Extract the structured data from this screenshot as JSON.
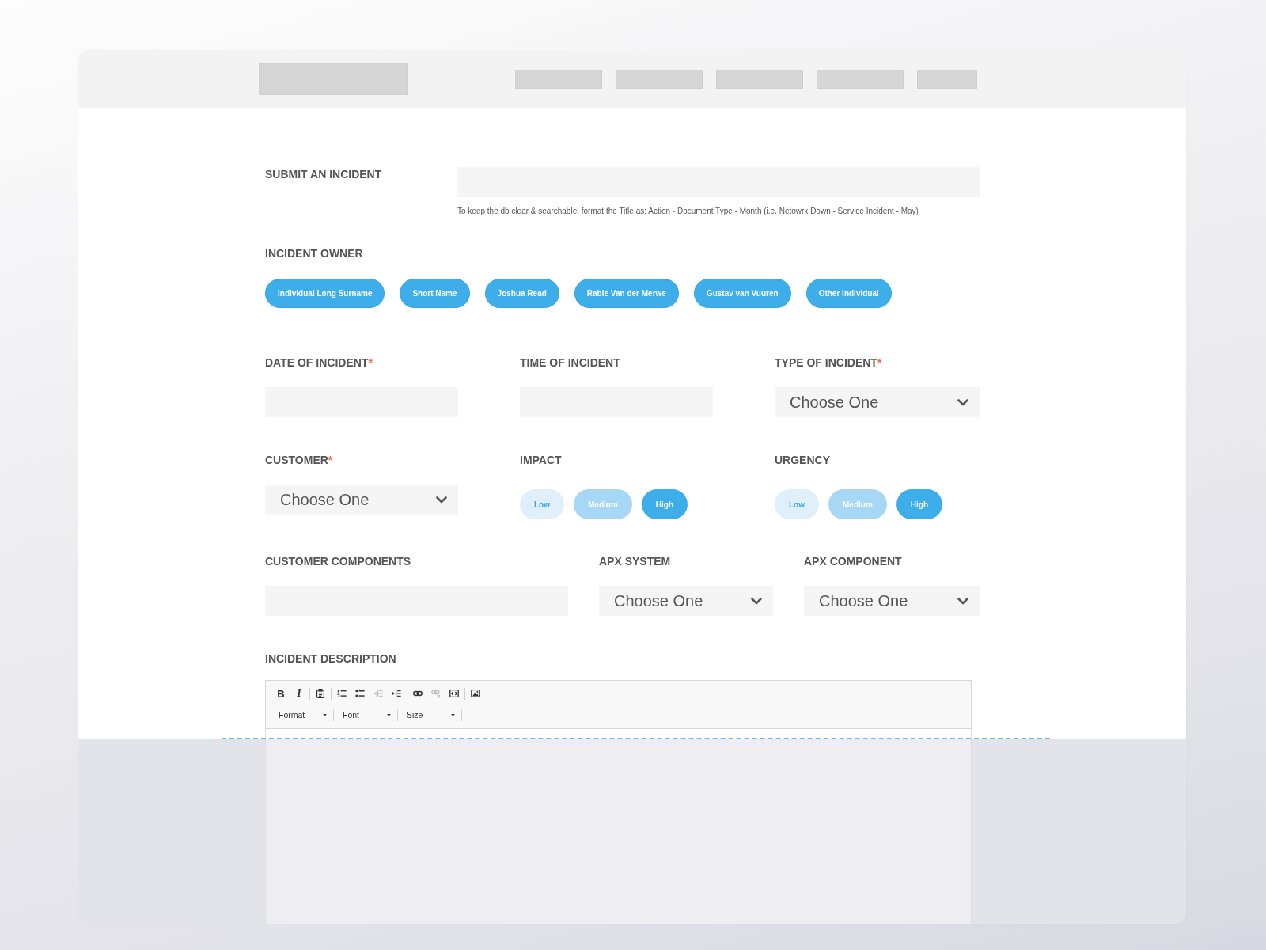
{
  "title_field": {
    "label": "SUBMIT AN INCIDENT",
    "hint": "To keep the db clear & searchable, format the Title as: Action - Document Type - Month (i.e. Netowrk Down - Service Incident - May)"
  },
  "incident_owner": {
    "label": "INCIDENT OWNER",
    "options": [
      "Individual Long Surname",
      "Short Name",
      "Joshua Read",
      "Rabie Van der Merwe",
      "Gustav van Vuuren",
      "Other Individual"
    ]
  },
  "field_rows": [
    [
      {
        "kind": "input",
        "label": "DATE OF INCIDENT",
        "required_mark": "*"
      },
      {
        "kind": "input",
        "label": "TIME OF INCIDENT"
      },
      {
        "kind": "select",
        "label": "TYPE OF INCIDENT",
        "required_mark": "*",
        "value": "Choose One"
      }
    ],
    [
      {
        "kind": "select",
        "label": "CUSTOMER",
        "required_mark": "*",
        "value": "Choose One"
      },
      {
        "kind": "scale",
        "label": "IMPACT",
        "options": [
          {
            "label": "Low",
            "color": "#dff0fb"
          },
          {
            "label": "Medium",
            "color": "#a6d8f5"
          },
          {
            "label": "High",
            "color": "#3daeea"
          }
        ]
      },
      {
        "kind": "scale",
        "label": "URGENCY",
        "options": [
          {
            "label": "Low",
            "color": "#dff0fb"
          },
          {
            "label": "Medium",
            "color": "#a6d8f5"
          },
          {
            "label": "High",
            "color": "#3daeea"
          }
        ]
      }
    ],
    [
      {
        "kind": "input",
        "label": "CUSTOMER COMPONENTS"
      },
      {
        "kind": "select",
        "label": "APX SYSTEM",
        "value": "Choose One"
      },
      {
        "kind": "select",
        "label": "APX COMPONENT",
        "value": "Choose One"
      }
    ]
  ],
  "description": {
    "label": "INCIDENT DESCRIPTION",
    "toolbar": {
      "groups": [
        [
          {
            "kind": "bold",
            "label": "B",
            "disabled": false
          },
          {
            "kind": "italic",
            "label": "I",
            "disabled": false
          }
        ],
        [
          {
            "kind": "paste",
            "disabled": false
          }
        ],
        [
          {
            "kind": "numbered-list",
            "disabled": false
          },
          {
            "kind": "bulleted-list",
            "disabled": false
          },
          {
            "kind": "outdent",
            "disabled": true
          },
          {
            "kind": "indent",
            "disabled": false
          }
        ],
        [
          {
            "kind": "link",
            "disabled": false
          },
          {
            "kind": "unlink",
            "disabled": true
          },
          {
            "kind": "code",
            "disabled": false
          }
        ],
        [
          {
            "kind": "image",
            "disabled": false
          }
        ]
      ],
      "dropdowns": [
        "Format",
        "Font",
        "Size"
      ]
    }
  }
}
